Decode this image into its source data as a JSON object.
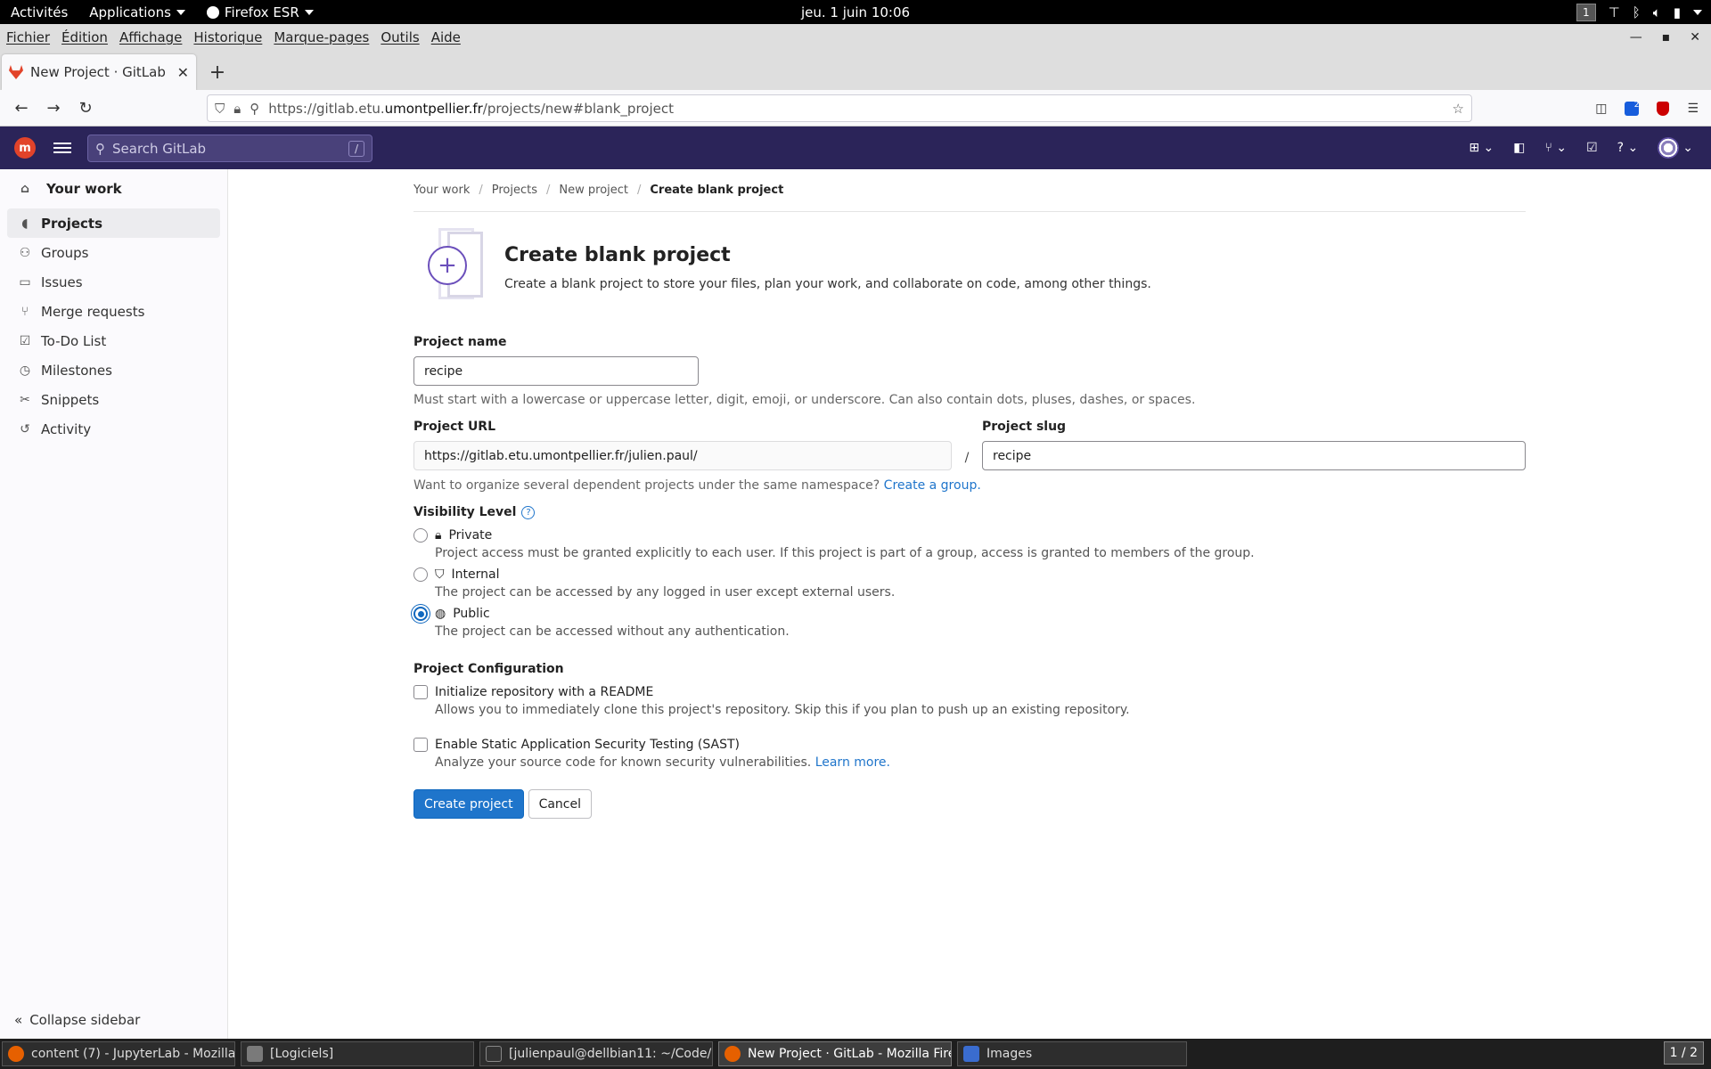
{
  "gnome": {
    "activities": "Activités",
    "applications": "Applications",
    "firefox": "Firefox ESR",
    "clock": "jeu. 1 juin  10:06",
    "workspace": "1"
  },
  "firefox": {
    "menu": [
      "Fichier",
      "Édition",
      "Affichage",
      "Historique",
      "Marque-pages",
      "Outils",
      "Aide"
    ],
    "tab_title": "New Project · GitLab",
    "url_prefix": "https://gitlab.etu.",
    "url_host": "umontpellier.fr",
    "url_path": "/projects/new#blank_project",
    "extension_badge": "2"
  },
  "gitlab_header": {
    "search_placeholder": "Search GitLab",
    "search_shortcut": "/"
  },
  "sidebar": {
    "title": "Your work",
    "items": [
      {
        "label": "Projects",
        "icon": "project-icon"
      },
      {
        "label": "Groups",
        "icon": "group-icon"
      },
      {
        "label": "Issues",
        "icon": "issues-icon"
      },
      {
        "label": "Merge requests",
        "icon": "merge-request-icon"
      },
      {
        "label": "To-Do List",
        "icon": "todo-icon"
      },
      {
        "label": "Milestones",
        "icon": "milestone-icon"
      },
      {
        "label": "Snippets",
        "icon": "snippet-icon"
      },
      {
        "label": "Activity",
        "icon": "history-icon"
      }
    ],
    "collapse": "Collapse sidebar"
  },
  "breadcrumb": [
    "Your work",
    "Projects",
    "New project",
    "Create blank project"
  ],
  "page": {
    "title": "Create blank project",
    "description": "Create a blank project to store your files, plan your work, and collaborate on code, among other things."
  },
  "form": {
    "project_name_label": "Project name",
    "project_name_value": "recipe",
    "project_name_help": "Must start with a lowercase or uppercase letter, digit, emoji, or underscore. Can also contain dots, pluses, dashes, or spaces.",
    "project_url_label": "Project URL",
    "project_url_value": "https://gitlab.etu.umontpellier.fr/julien.paul/",
    "url_separator": "/",
    "project_slug_label": "Project slug",
    "project_slug_value": "recipe",
    "namespace_help": "Want to organize several dependent projects under the same namespace?",
    "create_group_link": "Create a group.",
    "visibility_label": "Visibility Level",
    "visibility": [
      {
        "label": "Private",
        "icon": "lock-icon",
        "desc": "Project access must be granted explicitly to each user. If this project is part of a group, access is granted to members of the group.",
        "checked": false
      },
      {
        "label": "Internal",
        "icon": "shield-icon",
        "desc": "The project can be accessed by any logged in user except external users.",
        "checked": false
      },
      {
        "label": "Public",
        "icon": "globe-icon",
        "desc": "The project can be accessed without any authentication.",
        "checked": true
      }
    ],
    "config_label": "Project Configuration",
    "readme_label": "Initialize repository with a README",
    "readme_help": "Allows you to immediately clone this project's repository. Skip this if you plan to push up an existing repository.",
    "sast_label": "Enable Static Application Security Testing (SAST)",
    "sast_help": "Analyze your source code for known security vulnerabilities.",
    "learn_more": "Learn more.",
    "create_button": "Create project",
    "cancel_button": "Cancel"
  },
  "taskbar": {
    "tasks": [
      {
        "label": "content (7) - JupyterLab - Mozilla ...",
        "color": "#e66000"
      },
      {
        "label": "[Logiciels]",
        "color": "#7a7a7a"
      },
      {
        "label": "[julienpaul@dellbian11: ~/Code/...",
        "color": "#333333"
      },
      {
        "label": "New Project · GitLab - Mozilla Fire...",
        "color": "#e66000"
      },
      {
        "label": "Images",
        "color": "#3a6ccf"
      }
    ],
    "pager": "1 / 2"
  }
}
